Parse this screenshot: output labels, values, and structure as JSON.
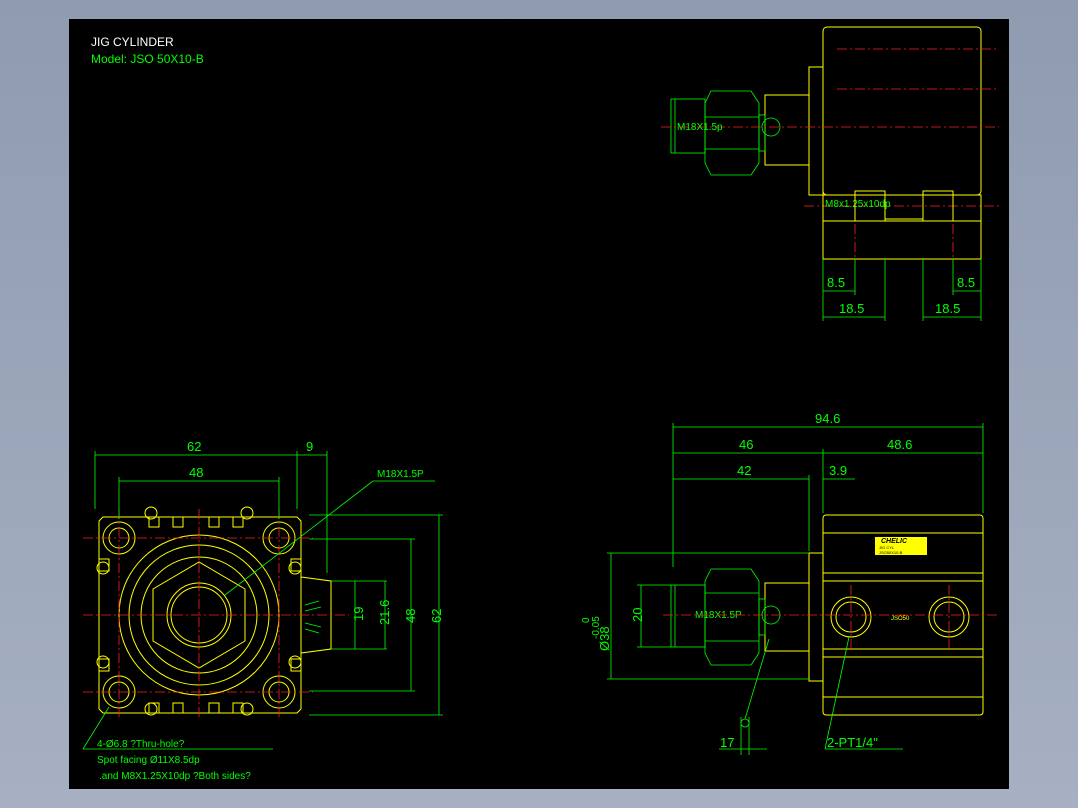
{
  "title": {
    "line1": "JIG CYLINDER",
    "line2": "Model:  JSO  50X10-B"
  },
  "colors": {
    "background": "#000000",
    "outline": "#ffff00",
    "dimension": "#00ff00",
    "centerline": "#ff2020",
    "viewport_frame": "#9aa5b8"
  },
  "top_view": {
    "thread_label": "M18X1.5p",
    "port_label": "M8x1.25x10dp",
    "dims": {
      "left_inner": "8.5",
      "right_inner": "8.5",
      "left_outer": "18.5",
      "right_outer": "18.5"
    }
  },
  "front_view": {
    "dims": {
      "width_62": "62",
      "hole_48": "48",
      "offset_9": "9",
      "h19": "19",
      "h21_6": "21.6",
      "h48": "48",
      "h62": "62"
    },
    "thread_callout": "M18X1.5P",
    "note_line1": "4-Ø6.8      ?Thru-hole?",
    "note_line2": "Spot facing  Ø11X8.5dp",
    "note_line3": ".and M8X1.25X10dp ?Both sides?"
  },
  "side_view": {
    "dims": {
      "total": "94.6",
      "left": "46",
      "right": "48.6",
      "inner": "42",
      "gap": "3.9",
      "d20": "20",
      "d38": "Ø38",
      "tol_upper": "0",
      "tol_lower": "-0.05",
      "d17": "17"
    },
    "thread_label": "M18X1.5P",
    "port_callout": "2-PT1/4\"",
    "brand": "CHELIC",
    "plate_small": "JSO50",
    "plate_line1": "JIG CYL",
    "plate_line2": "JSO50X10-B"
  }
}
